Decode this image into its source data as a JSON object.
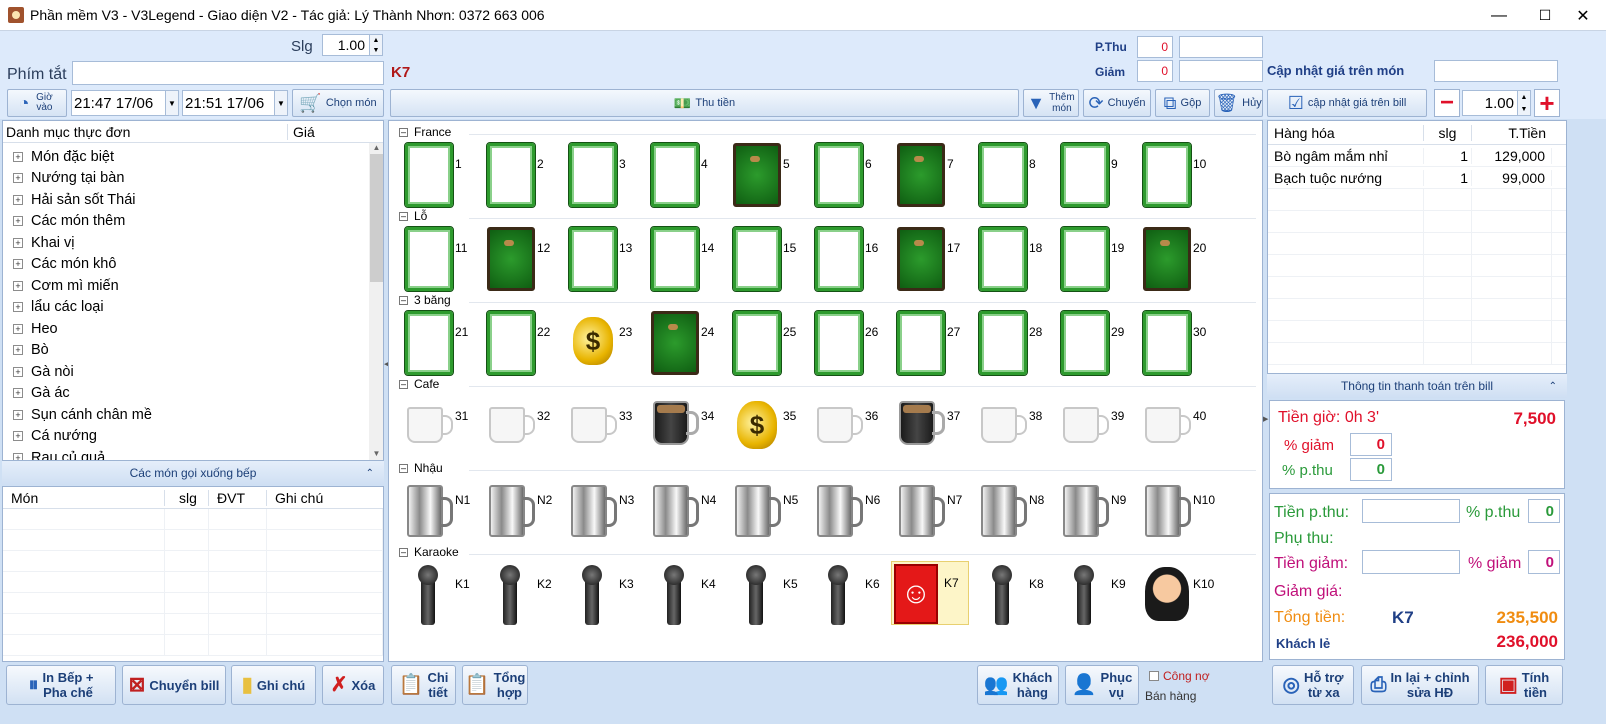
{
  "window": {
    "title": "Phần mềm V3 - V3Legend - Giao diện V2 - Tác giả: Lý Thành Nhơn: 0372 663 006",
    "min": "—",
    "max": "☐",
    "close": "✕"
  },
  "toolbar": {
    "slg_label": "Slg",
    "slg_value": "1.00",
    "shortcut_label": "Phím tắt",
    "shortcut_value": "",
    "current_table": "K7",
    "pthu_label": "P.Thu",
    "pthu_value": "0",
    "pthu_extra": "",
    "giam_label": "Giảm",
    "giam_value": "0",
    "giam_extra": "",
    "update_price_label": "Cập nhật giá trên món",
    "update_price_value": "",
    "gio_vao_label": "Giờ vào",
    "time_in": "21:47 17/06",
    "time_out": "21:51 17/06",
    "chon_mon": "Chọn món",
    "thu_tien": "Thu tiền",
    "them_mon": "Thêm món",
    "chuyen": "Chuyển",
    "gop": "Gộp",
    "huy": "Hủy",
    "cap_nhat_gia_bill": "cập nhật giá trên bill",
    "qty_value": "1.00"
  },
  "menu": {
    "header_name": "Danh mục thực đơn",
    "header_price": "Giá",
    "items": [
      "Món đặc biệt",
      "Nướng tại bàn",
      "Hải sản sốt Thái",
      "Các món thêm",
      "Khai vị",
      "Các món khô",
      "Cơm mì miến",
      "lẩu các loại",
      "Heo",
      "Bò",
      "Gà nòi",
      "Gà ác",
      "Sụn cánh chân mề",
      "Cá nướng",
      "Rau củ quả"
    ]
  },
  "kitchen": {
    "title": "Các món gọi xuống bếp",
    "cols": [
      "Món",
      "slg",
      "ĐVT",
      "Ghi chú"
    ]
  },
  "groups": [
    {
      "name": "France",
      "tables": [
        {
          "label": "1",
          "icon": "empty"
        },
        {
          "label": "2",
          "icon": "empty"
        },
        {
          "label": "3",
          "icon": "empty"
        },
        {
          "label": "4",
          "icon": "empty"
        },
        {
          "label": "5",
          "icon": "busy"
        },
        {
          "label": "6",
          "icon": "empty"
        },
        {
          "label": "7",
          "icon": "busy"
        },
        {
          "label": "8",
          "icon": "empty"
        },
        {
          "label": "9",
          "icon": "empty"
        },
        {
          "label": "10",
          "icon": "empty"
        }
      ]
    },
    {
      "name": "Lỗ",
      "tables": [
        {
          "label": "11",
          "icon": "empty"
        },
        {
          "label": "12",
          "icon": "busy"
        },
        {
          "label": "13",
          "icon": "empty"
        },
        {
          "label": "14",
          "icon": "empty"
        },
        {
          "label": "15",
          "icon": "empty"
        },
        {
          "label": "16",
          "icon": "empty"
        },
        {
          "label": "17",
          "icon": "busy"
        },
        {
          "label": "18",
          "icon": "empty"
        },
        {
          "label": "19",
          "icon": "empty"
        },
        {
          "label": "20",
          "icon": "busy"
        }
      ]
    },
    {
      "name": "3 băng",
      "tables": [
        {
          "label": "21",
          "icon": "empty"
        },
        {
          "label": "22",
          "icon": "empty"
        },
        {
          "label": "23",
          "icon": "money"
        },
        {
          "label": "24",
          "icon": "busy"
        },
        {
          "label": "25",
          "icon": "empty"
        },
        {
          "label": "26",
          "icon": "empty"
        },
        {
          "label": "27",
          "icon": "empty"
        },
        {
          "label": "28",
          "icon": "empty"
        },
        {
          "label": "29",
          "icon": "empty"
        },
        {
          "label": "30",
          "icon": "empty"
        }
      ]
    },
    {
      "name": "Cafe",
      "tables": [
        {
          "label": "31",
          "icon": "mug"
        },
        {
          "label": "32",
          "icon": "mug"
        },
        {
          "label": "33",
          "icon": "mug"
        },
        {
          "label": "34",
          "icon": "coffee"
        },
        {
          "label": "35",
          "icon": "money"
        },
        {
          "label": "36",
          "icon": "mug"
        },
        {
          "label": "37",
          "icon": "coffee"
        },
        {
          "label": "38",
          "icon": "mug"
        },
        {
          "label": "39",
          "icon": "mug"
        },
        {
          "label": "40",
          "icon": "mug"
        }
      ]
    },
    {
      "name": "Nhậu",
      "tables": [
        {
          "label": "N1",
          "icon": "beer"
        },
        {
          "label": "N2",
          "icon": "beer"
        },
        {
          "label": "N3",
          "icon": "beer"
        },
        {
          "label": "N4",
          "icon": "beer"
        },
        {
          "label": "N5",
          "icon": "beer"
        },
        {
          "label": "N6",
          "icon": "beer"
        },
        {
          "label": "N7",
          "icon": "beer"
        },
        {
          "label": "N8",
          "icon": "beer"
        },
        {
          "label": "N9",
          "icon": "beer"
        },
        {
          "label": "N10",
          "icon": "beer"
        }
      ]
    },
    {
      "name": "Karaoke",
      "tables": [
        {
          "label": "K1",
          "icon": "mic"
        },
        {
          "label": "K2",
          "icon": "mic"
        },
        {
          "label": "K3",
          "icon": "mic"
        },
        {
          "label": "K4",
          "icon": "mic"
        },
        {
          "label": "K5",
          "icon": "mic"
        },
        {
          "label": "K6",
          "icon": "mic"
        },
        {
          "label": "K7",
          "icon": "chat"
        },
        {
          "label": "K8",
          "icon": "mic"
        },
        {
          "label": "K9",
          "icon": "mic"
        },
        {
          "label": "K10",
          "icon": "singer"
        }
      ]
    }
  ],
  "bill": {
    "cols": [
      "Hàng hóa",
      "slg",
      "T.Tiền"
    ],
    "rows": [
      {
        "name": "Bò ngâm mắm nhỉ",
        "qty": "1",
        "total": "129,000"
      },
      {
        "name": "Bạch tuộc nướng",
        "qty": "1",
        "total": "99,000"
      }
    ]
  },
  "payment": {
    "title": "Thông tin thanh toán trên bill",
    "tien_gio_label": "Tiền giờ: 0h 3'",
    "tien_gio_value": "7,500",
    "pct_giam_label": "% giảm",
    "pct_giam_value": "0",
    "pct_pthu_label": "% p.thu",
    "pct_pthu_value": "0",
    "tien_pthu_label": "Tiền p.thu:",
    "pct_pthu2_label": "% p.thu",
    "pct_pthu2_value": "0",
    "phu_thu_label": "Phụ thu:",
    "tien_giam_label": "Tiền giảm:",
    "pct_giam2_label": "% giảm",
    "pct_giam2_value": "0",
    "giam_gia_label": "Giảm giá:",
    "tong_tien_label": "Tổng tiền:",
    "tong_table": "K7",
    "tong_value": "235,500",
    "khach_label": "Khách lẻ",
    "khach_value": "236,000"
  },
  "bottom": {
    "in_bep": "In Bếp +\nPha chế",
    "chuyen_bill": "Chuyển bill",
    "ghi_chu": "Ghi chú",
    "xoa": "Xóa",
    "chi_tiet": "Chi\ntiết",
    "tong_hop": "Tổng\nhợp",
    "khach_hang": "Khách\nhàng",
    "phuc_vu": "Phục\nvụ",
    "cong_no": "Công nợ",
    "ban_hang": "Bán hàng",
    "ho_tro": "Hỗ trợ\ntừ xa",
    "in_lai": "In lại + chỉnh\nsửa HĐ",
    "tinh_tien": "Tính\ntiền"
  }
}
